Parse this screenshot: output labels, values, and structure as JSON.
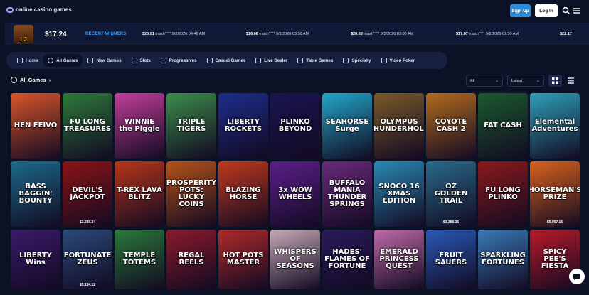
{
  "header": {
    "logo_text": "online casino games",
    "signup_label": "Sign Up",
    "login_label": "Log In"
  },
  "winners_bar": {
    "balance": "$17.24",
    "avatar_label": "LJ",
    "recent_label": "RECENT WINNERS",
    "items": [
      {
        "amount": "$20.91",
        "text": "mash**** 9/2/2026 04:48 AM"
      },
      {
        "amount": "$16.66",
        "text": "mash**** 9/2/2026 03:58 AM"
      },
      {
        "amount": "$20.88",
        "text": "mash**** 9/2/2026 03:00 AM"
      },
      {
        "amount": "$17.87",
        "text": "mash**** 9/2/2026 01:50 AM"
      },
      {
        "amount": "$22.17",
        "text": ""
      }
    ]
  },
  "nav": {
    "items": [
      {
        "label": "Home",
        "icon": "home-icon"
      },
      {
        "label": "All Games",
        "icon": "play-icon"
      },
      {
        "label": "New Games",
        "icon": "sparkle-icon"
      },
      {
        "label": "Slots",
        "icon": "slots-icon"
      },
      {
        "label": "Progressives",
        "icon": "progressive-icon"
      },
      {
        "label": "Casual Games",
        "icon": "casual-icon"
      },
      {
        "label": "Live Dealer",
        "icon": "dealer-icon"
      },
      {
        "label": "Table Games",
        "icon": "table-icon"
      },
      {
        "label": "Specialty",
        "icon": "specialty-icon"
      },
      {
        "label": "Video Poker",
        "icon": "poker-icon"
      }
    ]
  },
  "games_section": {
    "title": "All Games",
    "filter_value": "All",
    "sort_value": "Latest"
  },
  "games": [
    {
      "title": "HEN FEIVO",
      "jackpot": "",
      "bg": "#d9562a"
    },
    {
      "title": "FU LONG TREASURES",
      "jackpot": "",
      "bg": "#2d7a3a"
    },
    {
      "title": "WINNIE the Piggie",
      "jackpot": "",
      "bg": "#c23f9b"
    },
    {
      "title": "TRIPLE TIGERS",
      "jackpot": "",
      "bg": "#3d8c4a"
    },
    {
      "title": "LIBERTY ROCKETS",
      "jackpot": "",
      "bg": "#1d2d8a"
    },
    {
      "title": "PLINKO BEYOND",
      "jackpot": "",
      "bg": "#1a1552"
    },
    {
      "title": "SEAHORSE Surge",
      "jackpot": "",
      "bg": "#22a7c9"
    },
    {
      "title": "OLYMPUS THUNDERHOLD",
      "jackpot": "",
      "bg": "#7a5a2a"
    },
    {
      "title": "COYOTE CASH 2",
      "jackpot": "",
      "bg": "#b36b1e"
    },
    {
      "title": "FAT CASH",
      "jackpot": "",
      "bg": "#1b5a2e"
    },
    {
      "title": "Elemental Adventures",
      "jackpot": "",
      "bg": "#2ea0b9"
    },
    {
      "title": "BASS BAGGIN' BOUNTY",
      "jackpot": "",
      "bg": "#1b6a8a"
    },
    {
      "title": "DEVIL'S JACKPOT",
      "jackpot": "$2,236.34",
      "bg": "#8a1414"
    },
    {
      "title": "T-REX LAVA BLITZ",
      "jackpot": "",
      "bg": "#b8361a"
    },
    {
      "title": "PROSPERITY POTS: LUCKY COINS",
      "jackpot": "",
      "bg": "#b5521a"
    },
    {
      "title": "BLAZING HORSE",
      "jackpot": "",
      "bg": "#c0391c"
    },
    {
      "title": "3x WOW WHEELS",
      "jackpot": "",
      "bg": "#5b1f8a"
    },
    {
      "title": "BUFFALO MANIA THUNDER SPRINGS",
      "jackpot": "",
      "bg": "#6a2a7a"
    },
    {
      "title": "SNOCO 16 XMAS EDITION",
      "jackpot": "",
      "bg": "#2a8ab6"
    },
    {
      "title": "OZ GOLDEN TRAIL",
      "jackpot": "$3,388.36",
      "bg": "#2a6a8a"
    },
    {
      "title": "FU LONG PLINKO",
      "jackpot": "",
      "bg": "#8a1a1a"
    },
    {
      "title": "HORSEMAN'S PRIZE",
      "jackpot": "$5,097.15",
      "bg": "#d9621c"
    },
    {
      "title": "LIBERTY Wins",
      "jackpot": "",
      "bg": "#3a1a6a"
    },
    {
      "title": "FORTUNATE ZEUS",
      "jackpot": "$5,134.12",
      "bg": "#2a4a7a"
    },
    {
      "title": "TEMPLE TOTEMS",
      "jackpot": "",
      "bg": "#2a7a3a"
    },
    {
      "title": "REGAL REELS",
      "jackpot": "",
      "bg": "#8a1a2a"
    },
    {
      "title": "HOT POTS MASTER",
      "jackpot": "",
      "bg": "#b02a2a"
    },
    {
      "title": "WHISPERS OF SEASONS",
      "jackpot": "",
      "bg": "#c7aab8"
    },
    {
      "title": "HADES' FLAMES OF FORTUNE",
      "jackpot": "",
      "bg": "#2a1a5a"
    },
    {
      "title": "EMERALD PRINCESS QUEST",
      "jackpot": "",
      "bg": "#c06aa8"
    },
    {
      "title": "FRUIT SAUERS",
      "jackpot": "",
      "bg": "#2a5ab8"
    },
    {
      "title": "SPARKLING FORTUNES",
      "jackpot": "",
      "bg": "#3a7ab8"
    },
    {
      "title": "SPICY PEE'S FIESTA",
      "jackpot": "",
      "bg": "#b81a2a"
    }
  ]
}
